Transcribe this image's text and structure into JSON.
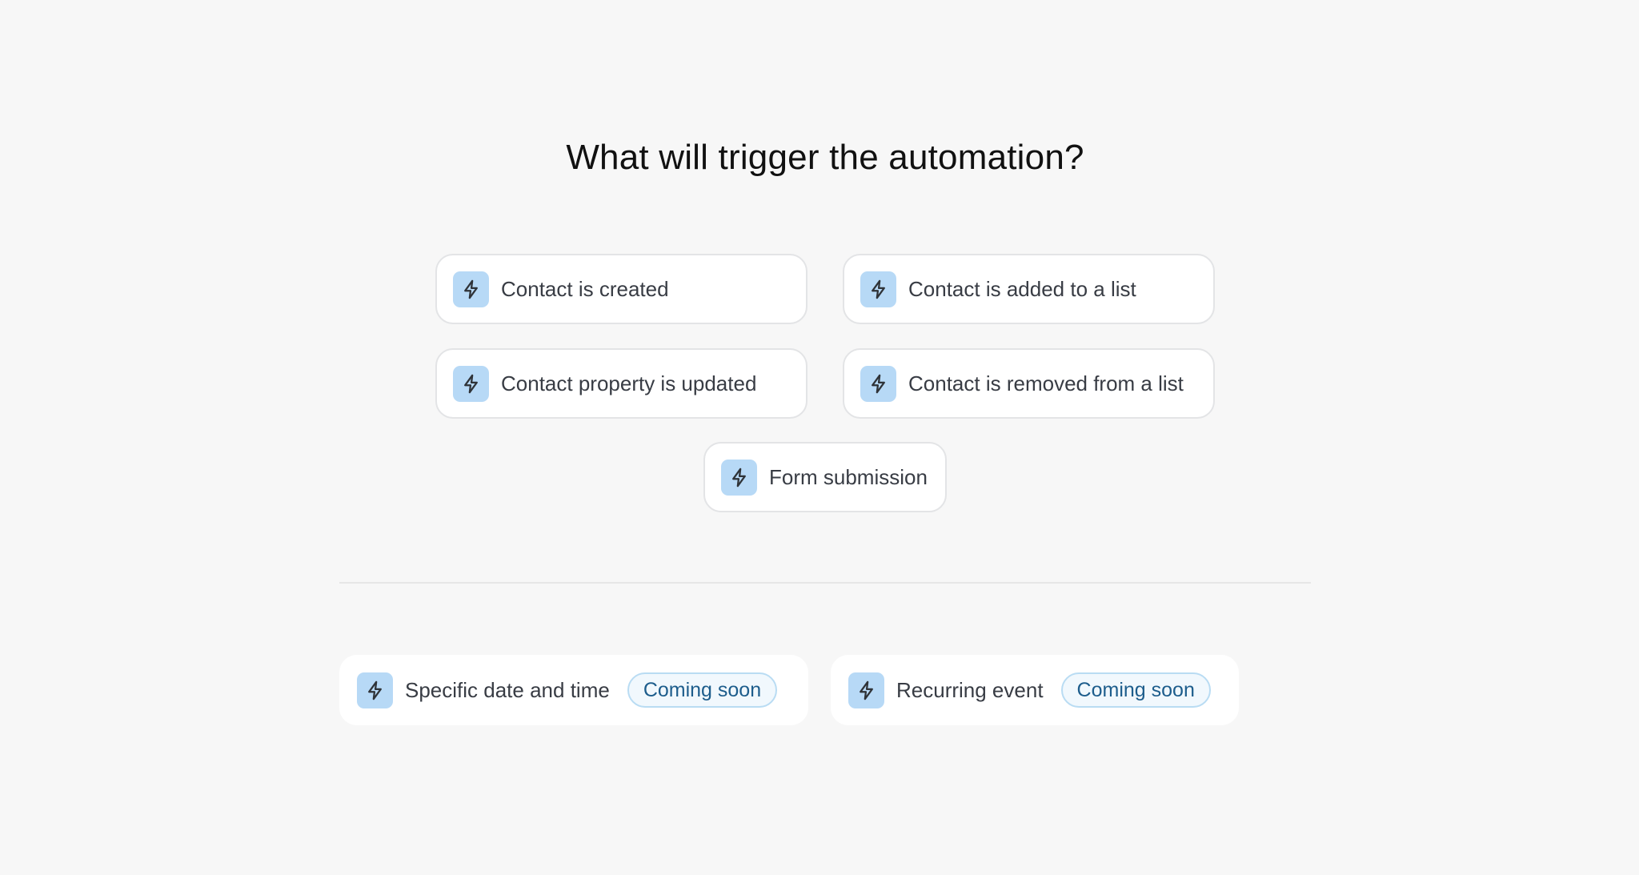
{
  "heading": "What will trigger the automation?",
  "triggers": [
    {
      "label": "Contact is created",
      "icon": "lightning-bolt-icon"
    },
    {
      "label": "Contact is added to a list",
      "icon": "lightning-bolt-icon"
    },
    {
      "label": "Contact property is updated",
      "icon": "lightning-bolt-icon"
    },
    {
      "label": "Contact is removed from a list",
      "icon": "lightning-bolt-icon"
    },
    {
      "label": "Form submission",
      "icon": "lightning-bolt-icon"
    }
  ],
  "upcoming": [
    {
      "label": "Specific date and time",
      "badge": "Coming soon",
      "icon": "lightning-bolt-icon"
    },
    {
      "label": "Recurring event",
      "badge": "Coming soon",
      "icon": "lightning-bolt-icon"
    }
  ],
  "colors": {
    "background": "#f7f7f7",
    "icon_tile": "#b7d9f6",
    "badge_text": "#1d5d8c",
    "badge_border": "#b9dcf3"
  }
}
